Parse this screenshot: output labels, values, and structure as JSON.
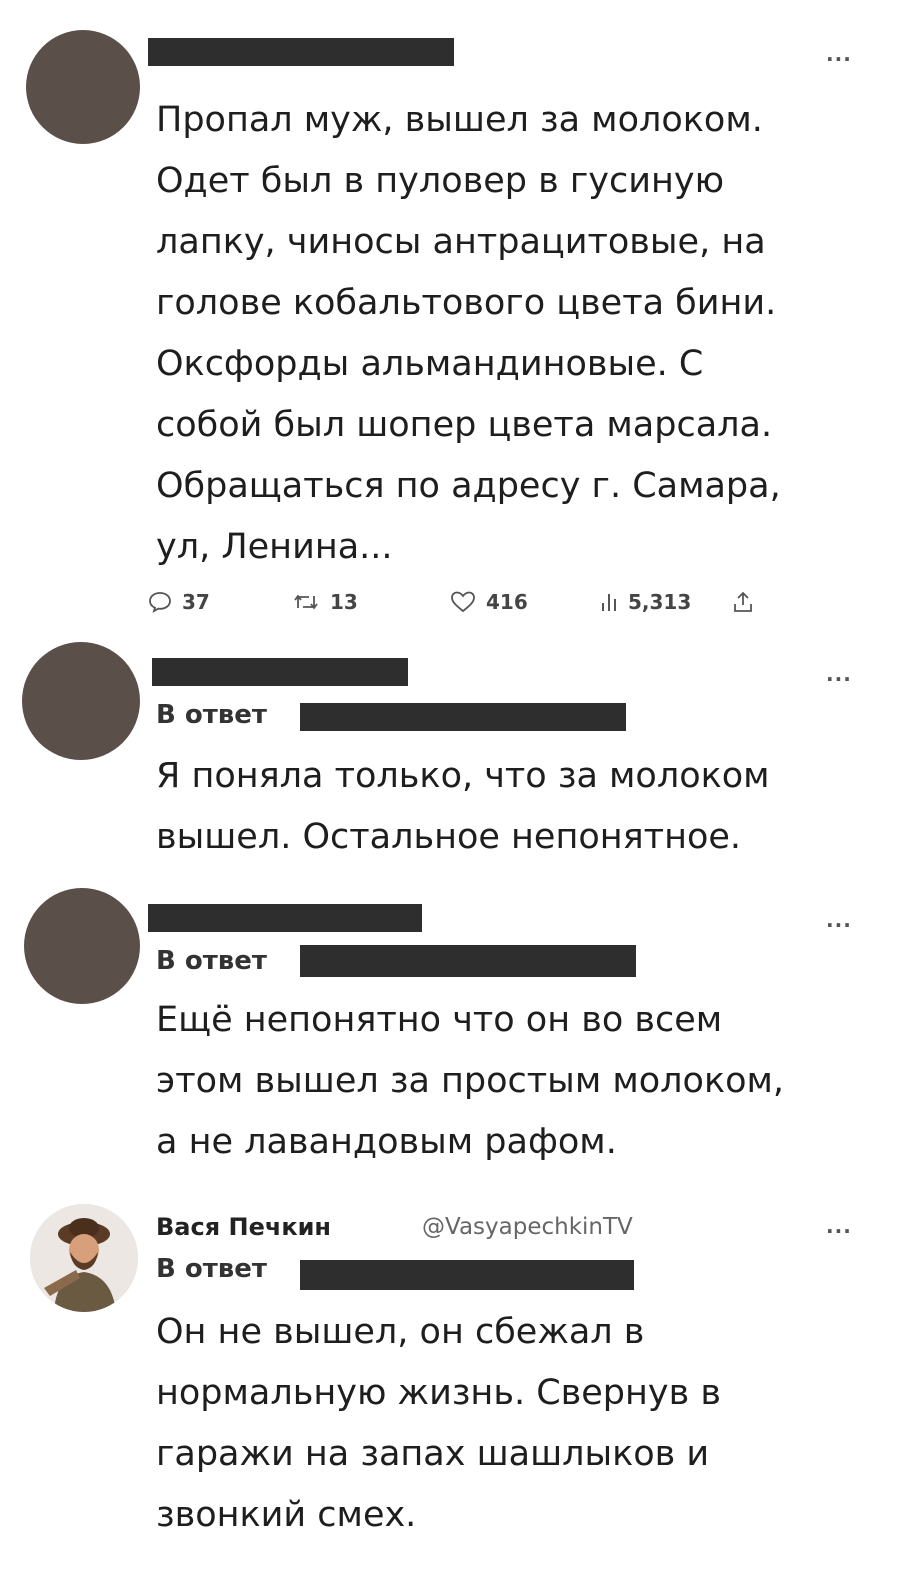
{
  "tweets": [
    {
      "text": "Пропал муж, вышел за молоком.\nОдет был в пуловер в гусиную\nлапку, чиносы антрацитовые, на\nголове кобальтового цвета бини.\nОксфорды альмандиновые. С\nсобой был шопер цвета марсала.\nОбращаться по адресу г. Самара,\nул, Ленина...",
      "more": "...",
      "actions": {
        "replies": "37",
        "retweets": "13",
        "likes": "416",
        "views": "5,313"
      }
    },
    {
      "reply_label": "В ответ",
      "text": "Я поняла только, что за молоком\nвышел. Остальное непонятное.",
      "more": "..."
    },
    {
      "reply_label": "В ответ",
      "text": "Ещё непонятно что он во всем\nэтом вышел за простым молоком,\nа не лавандовым рафом.",
      "more": "..."
    },
    {
      "user_name": "Вася Печкин",
      "handle": "@VasyapechkinTV",
      "reply_label": "В ответ",
      "text": "Он не вышел, он сбежал в\nнормальную жизнь. Свернув в\nгаражи на запах шашлыков и\nзвонкий смех.",
      "more": "..."
    }
  ],
  "icons": [
    "reply-icon",
    "retweet-icon",
    "like-icon",
    "views-icon",
    "share-icon",
    "more-icon"
  ],
  "colors": {
    "avatar": "#5b4f4a",
    "redaction": "#2e2e2e",
    "text": "#1e1e1e"
  }
}
